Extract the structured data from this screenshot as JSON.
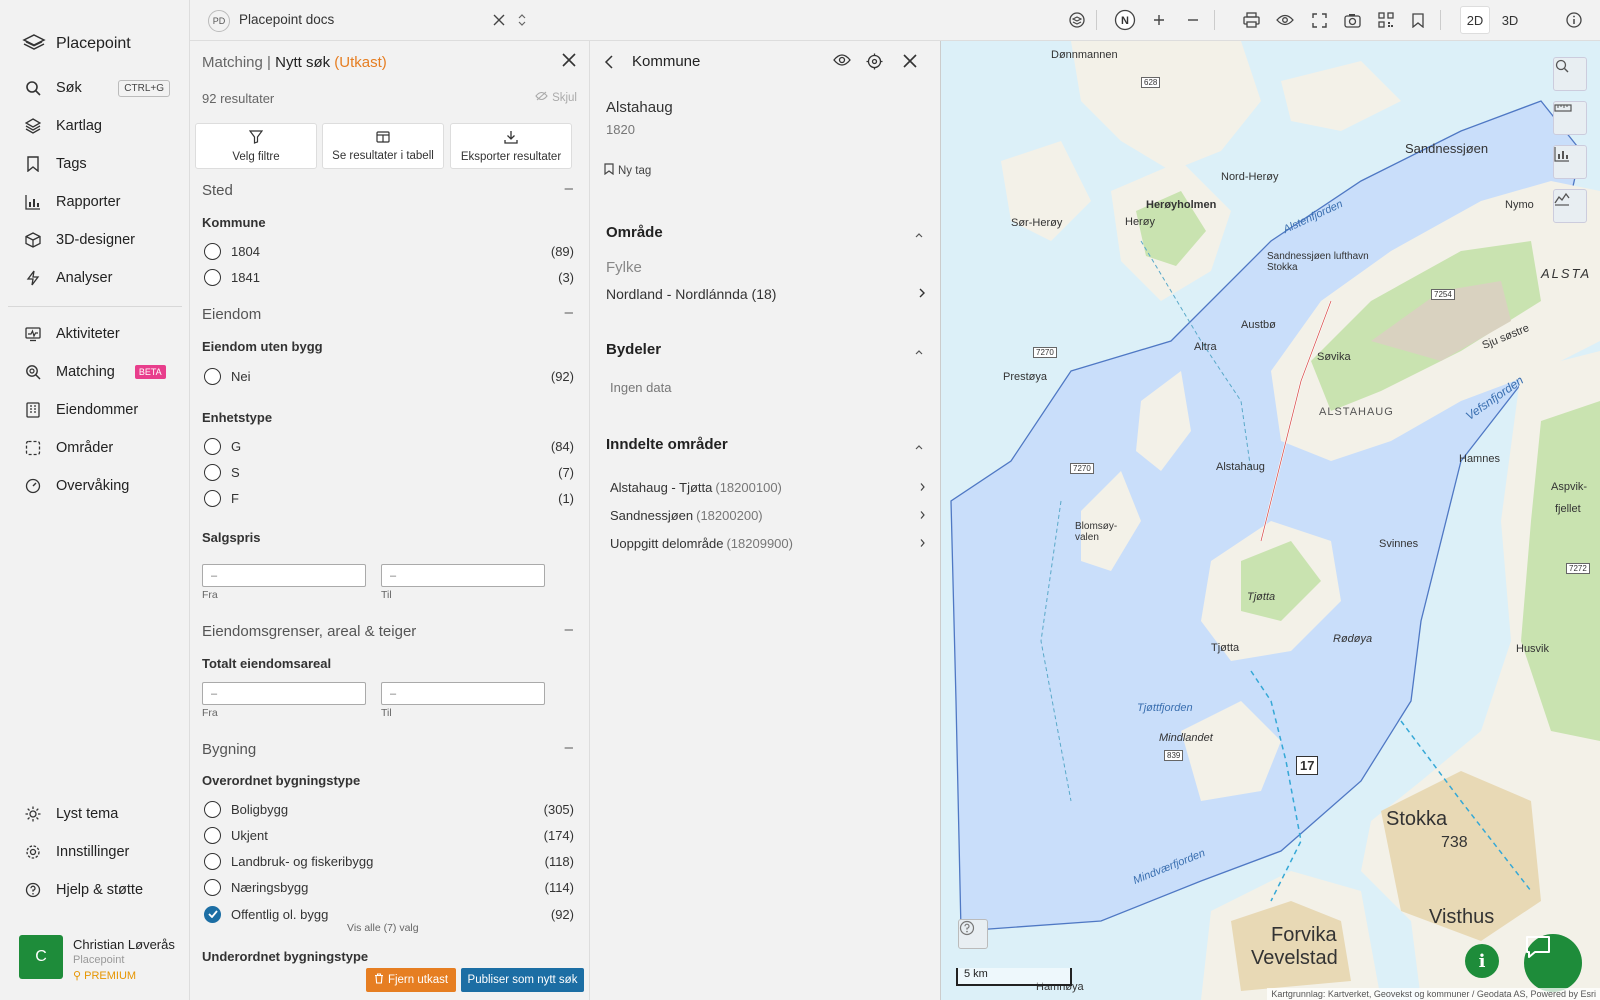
{
  "app": {
    "name": "Placepoint"
  },
  "sidebar": {
    "items": [
      {
        "label": "Søk",
        "icon": "search-icon",
        "shortcut": "CTRL+G"
      },
      {
        "label": "Kartlag",
        "icon": "layers-icon"
      },
      {
        "label": "Tags",
        "icon": "bookmark-icon"
      },
      {
        "label": "Rapporter",
        "icon": "bar-chart-icon"
      },
      {
        "label": "3D-designer",
        "icon": "cube-icon"
      },
      {
        "label": "Analyser",
        "icon": "lightning-icon"
      },
      {
        "label": "Aktiviteter",
        "icon": "activity-monitor-icon"
      },
      {
        "label": "Matching",
        "icon": "match-search-icon",
        "badge": "BETA"
      },
      {
        "label": "Eiendommer",
        "icon": "building-icon"
      },
      {
        "label": "Områder",
        "icon": "area-select-icon"
      },
      {
        "label": "Overvåking",
        "icon": "gauge-icon"
      }
    ],
    "bottom_items": [
      {
        "label": "Lyst tema",
        "icon": "sun-icon"
      },
      {
        "label": "Innstillinger",
        "icon": "gear-icon"
      },
      {
        "label": "Hjelp & støtte",
        "icon": "help-circle-icon"
      }
    ],
    "user": {
      "initial": "C",
      "name": "Christian Løverås",
      "org": "Placepoint",
      "tier": "PREMIUM"
    }
  },
  "topbar": {
    "doc_badge": "PD",
    "doc_title": "Placepoint docs",
    "compass": "N",
    "mode_2d": "2D",
    "mode_3d": "3D"
  },
  "filter_panel": {
    "title": "Matching",
    "separator": "|",
    "subtitle": "Nytt søk",
    "draft": "(Utkast)",
    "results": "92 resultater",
    "hide": "Skjul",
    "actions": {
      "filters": "Velg filtre",
      "table": "Se resultater i tabell",
      "export": "Eksporter resultater"
    },
    "sections": {
      "sted": {
        "title": "Sted",
        "kommune": {
          "label": "Kommune",
          "options": [
            {
              "label": "1804",
              "count": "(89)"
            },
            {
              "label": "1841",
              "count": "(3)"
            }
          ]
        }
      },
      "eiendom": {
        "title": "Eiendom",
        "uten_bygg": {
          "label": "Eiendom uten bygg",
          "options": [
            {
              "label": "Nei",
              "count": "(92)"
            }
          ]
        },
        "enhetstype": {
          "label": "Enhetstype",
          "options": [
            {
              "label": "G",
              "count": "(84)"
            },
            {
              "label": "S",
              "count": "(7)"
            },
            {
              "label": "F",
              "count": "(1)"
            }
          ]
        },
        "salgspris": {
          "label": "Salgspris",
          "placeholder": "–",
          "from": "Fra",
          "to": "Til"
        }
      },
      "grenser": {
        "title": "Eiendomsgrenser, areal & teiger",
        "areal": {
          "label": "Totalt eiendomsareal",
          "placeholder": "–",
          "from": "Fra",
          "to": "Til"
        }
      },
      "bygning": {
        "title": "Bygning",
        "overordnet": {
          "label": "Overordnet bygningstype",
          "options": [
            {
              "label": "Boligbygg",
              "count": "(305)"
            },
            {
              "label": "Ukjent",
              "count": "(174)"
            },
            {
              "label": "Landbruk- og fiskeribygg",
              "count": "(118)"
            },
            {
              "label": "Næringsbygg",
              "count": "(114)"
            },
            {
              "label": "Offentlig ol. bygg",
              "count": "(92)",
              "checked": true
            }
          ],
          "show_all": "Vis alle (7) valg"
        },
        "underordnet": {
          "label": "Underordnet bygningstype"
        }
      }
    },
    "buttons": {
      "delete": "Fjern utkast",
      "publish": "Publiser som nytt søk"
    }
  },
  "detail_panel": {
    "title": "Kommune",
    "name": "Alstahaug",
    "code": "1820",
    "new_tag": "Ny tag",
    "omrade": {
      "title": "Område",
      "fylke_label": "Fylke",
      "fylke_value": "Nordland - Nordlánnda",
      "fylke_count": "(18)"
    },
    "bydeler": {
      "title": "Bydeler",
      "empty": "Ingen data"
    },
    "inndelte": {
      "title": "Inndelte områder",
      "items": [
        {
          "name": "Alstahaug - Tjøtta",
          "code": "(18200100)"
        },
        {
          "name": "Sandnessjøen",
          "code": "(18200200)"
        },
        {
          "name": "Uoppgitt delområde",
          "code": "(18209900)"
        }
      ]
    }
  },
  "map": {
    "labels": {
      "dommannen": "Dønnmannen",
      "sandnessjoen": "Sandnessjøen",
      "nord_heroy": "Nord-Herøy",
      "heroyholmen": "Herøyholmen",
      "sor_heroy": "Sør-Herøy",
      "heroy": "Herøy",
      "alstenfjorden": "Alstenfjorden",
      "nymo": "Nymo",
      "lufthavn": "Sandnessjøen lufthavn Stokka",
      "alsta": "ALSTA",
      "sju_sostre": "Sju søstre",
      "austbo": "Austbø",
      "altra": "Altra",
      "sovika": "Søvika",
      "prestoya": "Prestøya",
      "alstahaug_caps": "ALSTAHAUG",
      "vefsnfjorden": "Vefsnfjorden",
      "alstahaug": "Alstahaug",
      "hamnes": "Hamnes",
      "aspvik": "Aspvik-",
      "fjellet": "fjellet",
      "blomsoyvalen": "Blomsøy-valen",
      "svinnes": "Svinnes",
      "tjotta": "Tjøtta",
      "tjotta_farm": "Tjøtta",
      "rodoya": "Rødøya",
      "husvik": "Husvik",
      "tjottfjorden": "Tjøttfjorden",
      "mindlandet": "Mindlandet",
      "stokka": "Stokka",
      "height_738": "738",
      "vistnes": "Visthus",
      "forvika": "Forvika",
      "vevelstad": "Vevelstad",
      "mindvaerfjorden": "Mindværfjorden",
      "hamnoya": "Hamnøya",
      "route_17": "17",
      "r7270a": "7270",
      "r7270b": "7270",
      "r7254": "7254",
      "r7272": "7272",
      "r628": "628",
      "r839": "839"
    },
    "scale": "5 km",
    "attribution": "Kartgrunnlag: Kartverket, Geovekst og kommuner / Geodata AS, Powered by Esri",
    "colors": {
      "sea": "#dbeef6",
      "land": "#f3f1e8",
      "forest": "#c9e3b0",
      "boundary": "#4f78c4"
    }
  }
}
